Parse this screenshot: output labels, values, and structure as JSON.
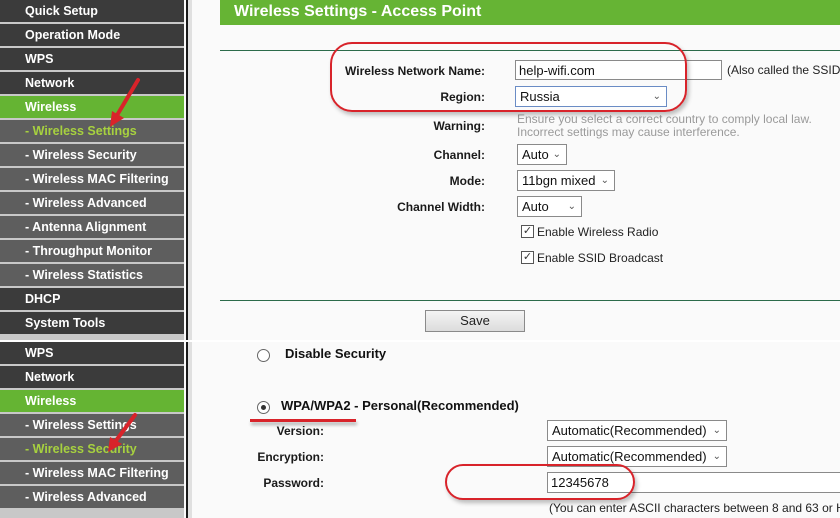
{
  "top": {
    "sidebar": [
      {
        "label": "Quick Setup",
        "type": "main"
      },
      {
        "label": "Operation Mode",
        "type": "main"
      },
      {
        "label": "WPS",
        "type": "main"
      },
      {
        "label": "Network",
        "type": "main"
      },
      {
        "label": "Wireless",
        "type": "active"
      },
      {
        "label": "- Wireless Settings",
        "type": "sub-current"
      },
      {
        "label": "- Wireless Security",
        "type": "sub"
      },
      {
        "label": "- Wireless MAC Filtering",
        "type": "sub"
      },
      {
        "label": "- Wireless Advanced",
        "type": "sub"
      },
      {
        "label": "- Antenna Alignment",
        "type": "sub"
      },
      {
        "label": "- Throughput Monitor",
        "type": "sub"
      },
      {
        "label": "- Wireless Statistics",
        "type": "sub"
      },
      {
        "label": "DHCP",
        "type": "main"
      },
      {
        "label": "System Tools",
        "type": "main"
      }
    ],
    "header_title": "Wireless Settings - Access Point",
    "form": {
      "network_name_label": "Wireless Network Name:",
      "network_name_value": "help-wifi.com",
      "network_name_hint": "(Also called the SSID)",
      "region_label": "Region:",
      "region_value": "Russia",
      "warning_label": "Warning:",
      "warning_line1": "Ensure you select a correct country to comply local law.",
      "warning_line2": "Incorrect settings may cause interference.",
      "channel_label": "Channel:",
      "channel_value": "Auto",
      "mode_label": "Mode:",
      "mode_value": "11bgn mixed",
      "channel_width_label": "Channel Width:",
      "channel_width_value": "Auto",
      "enable_radio_label": "Enable Wireless Radio",
      "enable_radio_checked": true,
      "enable_ssid_label": "Enable SSID Broadcast",
      "enable_ssid_checked": true,
      "save_label": "Save"
    }
  },
  "bottom": {
    "sidebar": [
      {
        "label": "WPS",
        "type": "main"
      },
      {
        "label": "Network",
        "type": "main"
      },
      {
        "label": "Wireless",
        "type": "active"
      },
      {
        "label": "- Wireless Settings",
        "type": "sub"
      },
      {
        "label": "- Wireless Security",
        "type": "sub-current"
      },
      {
        "label": "- Wireless MAC Filtering",
        "type": "sub"
      },
      {
        "label": "- Wireless Advanced",
        "type": "sub"
      }
    ],
    "security": {
      "disable_label": "Disable Security",
      "disable_selected": false,
      "wpa_label": "WPA/WPA2 - Personal(Recommended)",
      "wpa_selected": true,
      "version_label": "Version:",
      "version_value": "Automatic(Recommended)",
      "encryption_label": "Encryption:",
      "encryption_value": "Automatic(Recommended)",
      "password_label": "Password:",
      "password_value": "12345678",
      "password_hint": "(You can enter ASCII characters between 8 and 63 or H"
    }
  },
  "icons": {
    "chevron": "⌄",
    "check": "✓"
  },
  "colors": {
    "accent_green": "#66b434",
    "current_item_text": "#a7d13f",
    "annotation_red": "#d8232a"
  }
}
